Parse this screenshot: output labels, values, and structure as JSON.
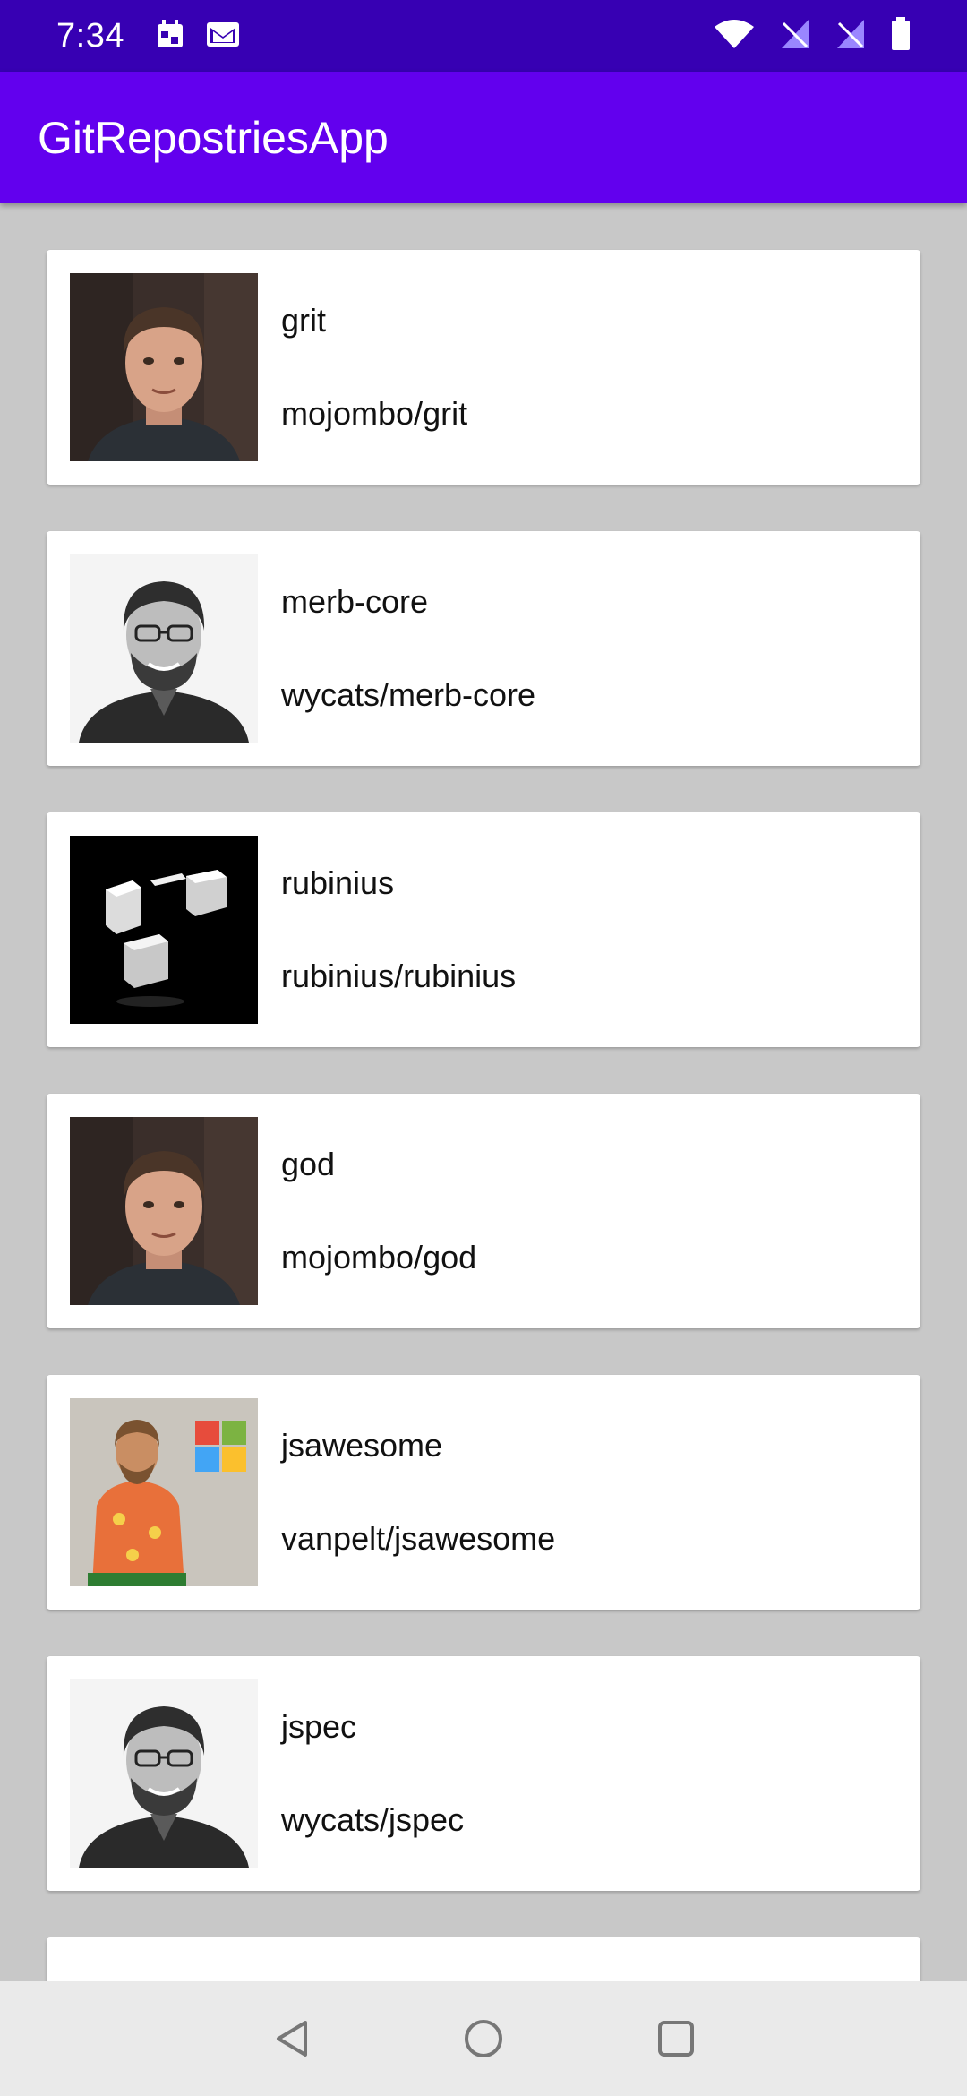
{
  "status_bar": {
    "time": "7:34",
    "notification_icons": [
      "calendar-icon",
      "mail-icon"
    ],
    "system_icons": [
      "wifi-icon",
      "signal-icon",
      "signal-icon",
      "battery-icon"
    ]
  },
  "app_bar": {
    "title": "GitRepostriesApp"
  },
  "repos": [
    {
      "name": "grit",
      "full_name": "mojombo/grit",
      "avatar": "avatar-mojombo"
    },
    {
      "name": "merb-core",
      "full_name": "wycats/merb-core",
      "avatar": "avatar-wycats"
    },
    {
      "name": "rubinius",
      "full_name": "rubinius/rubinius",
      "avatar": "avatar-rubinius"
    },
    {
      "name": "god",
      "full_name": "mojombo/god",
      "avatar": "avatar-mojombo"
    },
    {
      "name": "jsawesome",
      "full_name": "vanpelt/jsawesome",
      "avatar": "avatar-vanpelt"
    },
    {
      "name": "jspec",
      "full_name": "wycats/jspec",
      "avatar": "avatar-wycats"
    }
  ],
  "nav_bar": {
    "buttons": [
      "back-icon",
      "home-icon",
      "recents-icon"
    ]
  },
  "colors": {
    "status_bar": "#3700b3",
    "app_bar": "#6200ee",
    "list_bg": "#c8c8c8",
    "card_bg": "#ffffff",
    "nav_bar": "#eaeaea"
  }
}
